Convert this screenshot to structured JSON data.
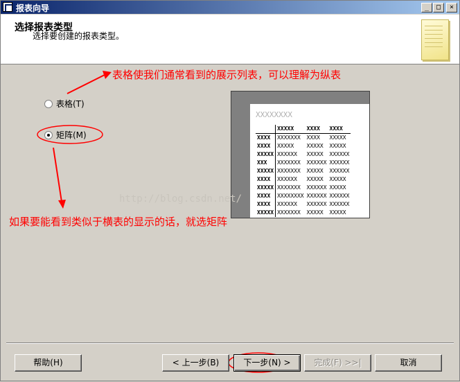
{
  "window": {
    "title": "报表向导"
  },
  "header": {
    "title": "选择报表类型",
    "subtitle": "选择要创建的报表类型。"
  },
  "options": [
    {
      "label": "表格(T)",
      "selected": false
    },
    {
      "label": "矩阵(M)",
      "selected": true
    }
  ],
  "preview": {
    "title": "XXXXXXXX",
    "columns": [
      "XXXXX",
      "XXXX",
      "XXXX"
    ],
    "rows": [
      [
        "XXXX",
        "XXXXXXX",
        "XXXX",
        "XXXXX"
      ],
      [
        "XXXX",
        "XXXXX",
        "XXXXX",
        "XXXXX"
      ],
      [
        "XXXXX",
        "XXXXXX",
        "XXXXX",
        "XXXXXX"
      ],
      [
        "XXX",
        "XXXXXXX",
        "XXXXXX",
        "XXXXXX"
      ],
      [
        "XXXXX",
        "XXXXXXX",
        "XXXXX",
        "XXXXXX"
      ],
      [
        "XXXX",
        "XXXXXX",
        "XXXXX",
        "XXXXX"
      ],
      [
        "XXXXX",
        "XXXXXXX",
        "XXXXXX",
        "XXXXX"
      ],
      [
        "XXXX",
        "XXXXXXXX",
        "XXXXXX",
        "XXXXXX"
      ],
      [
        "XXXX",
        "XXXXXX",
        "XXXXXX",
        "XXXXXX"
      ],
      [
        "XXXXX",
        "XXXXXXX",
        "XXXXX",
        "XXXXX"
      ]
    ]
  },
  "annotations": {
    "table_note": "表格使我们通常看到的展示列表，可以理解为纵表",
    "matrix_note": "如果要能看到类似于横表的显示的话，就选矩阵",
    "annotation_color": "#ff0000"
  },
  "watermark": "http://blog.csdn.net/",
  "buttons": {
    "help": "帮助(H)",
    "back": "< 上一步(B)",
    "next": "下一步(N) >",
    "finish": "完成(F) >>|",
    "cancel": "取消"
  }
}
